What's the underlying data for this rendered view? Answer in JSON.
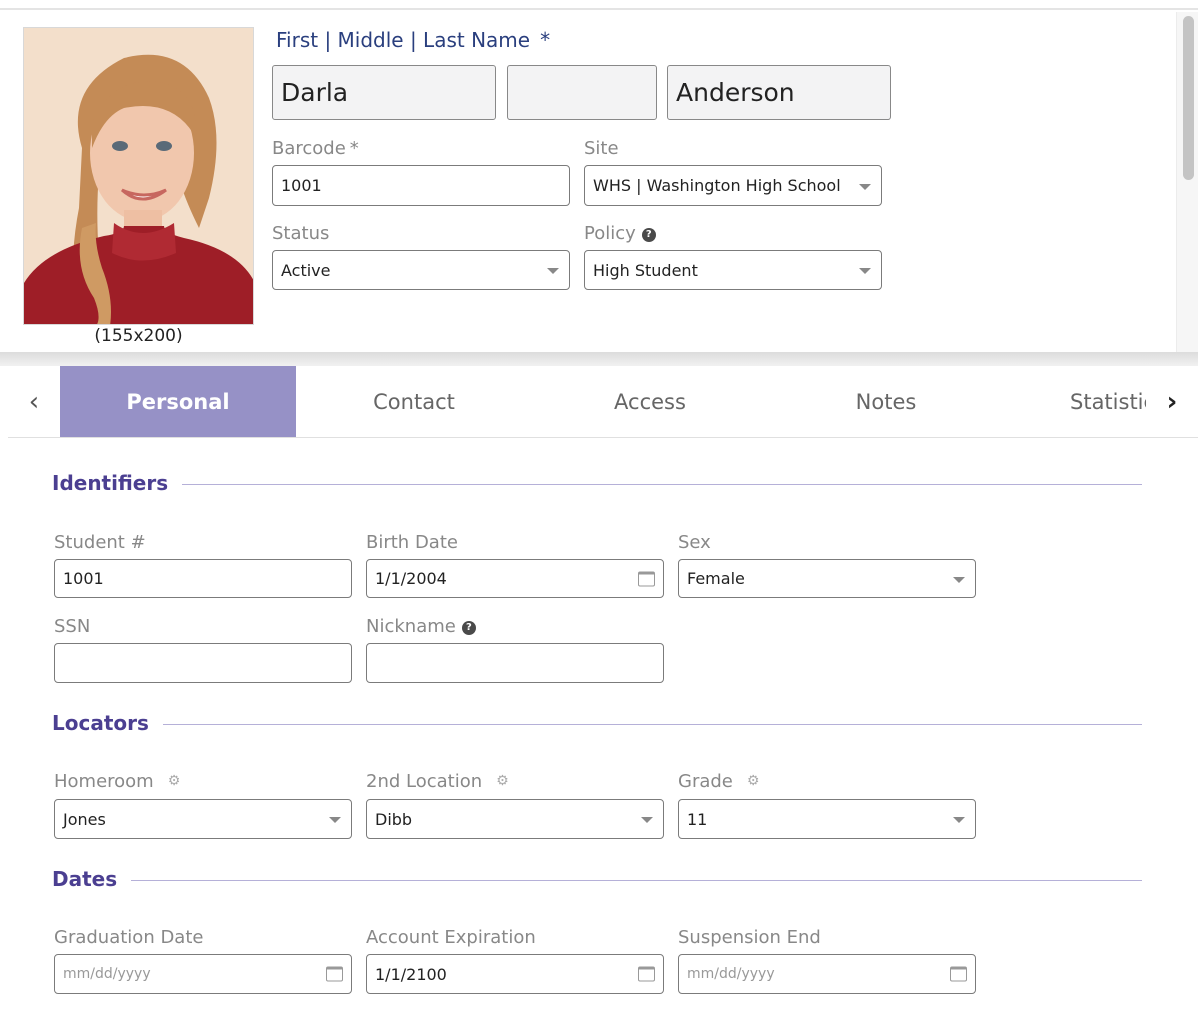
{
  "header": {
    "photo_caption": "(155x200)",
    "name_label": "First | Middle | Last Name",
    "required_mark": "*",
    "first_name": "Darla",
    "middle_name": "",
    "last_name": "Anderson",
    "barcode_label": "Barcode",
    "barcode_required_mark": "*",
    "barcode_value": "1001",
    "site_label": "Site",
    "site_value": "WHS | Washington High School",
    "status_label": "Status",
    "status_value": "Active",
    "policy_label": "Policy",
    "policy_value": "High Student"
  },
  "tabs": {
    "prev_icon": "chevron-left-icon",
    "next_icon": "chevron-right-icon",
    "items": [
      {
        "label": "Personal",
        "active": true
      },
      {
        "label": "Contact",
        "active": false
      },
      {
        "label": "Access",
        "active": false
      },
      {
        "label": "Notes",
        "active": false
      },
      {
        "label": "Statistics",
        "active": false
      }
    ]
  },
  "identifiers": {
    "title": "Identifiers",
    "student_no_label": "Student #",
    "student_no_value": "1001",
    "birth_date_label": "Birth Date",
    "birth_date_value": "1/1/2004",
    "sex_label": "Sex",
    "sex_value": "Female",
    "ssn_label": "SSN",
    "ssn_value": "",
    "nickname_label": "Nickname",
    "nickname_value": ""
  },
  "locators": {
    "title": "Locators",
    "homeroom_label": "Homeroom",
    "homeroom_value": "Jones",
    "second_location_label": "2nd Location",
    "second_location_value": "Dibb",
    "grade_label": "Grade",
    "grade_value": "11"
  },
  "dates": {
    "title": "Dates",
    "graduation_label": "Graduation Date",
    "graduation_placeholder": "mm/dd/yyyy",
    "account_expiration_label": "Account Expiration",
    "account_expiration_value": "1/1/2100",
    "suspension_end_label": "Suspension End",
    "suspension_end_placeholder": "mm/dd/yyyy"
  },
  "colors": {
    "accent": "#9691c6",
    "section_title": "#4b3f91",
    "name_heading": "#2a3f7e"
  }
}
